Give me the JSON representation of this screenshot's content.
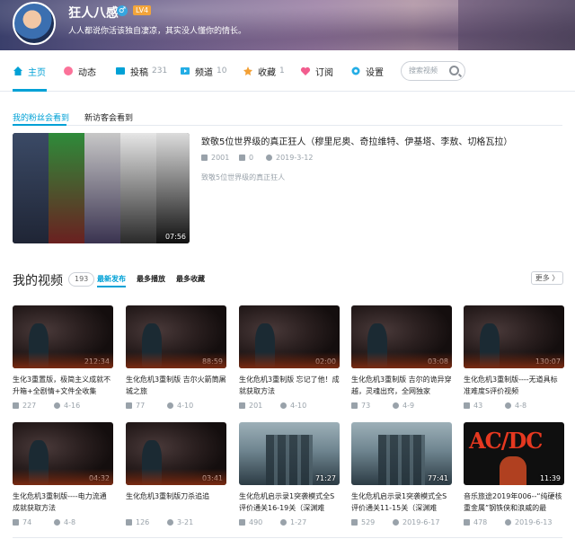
{
  "header": {
    "username": "狂人八感",
    "gender_icon": "male-icon",
    "level": "LV4",
    "signature": "人人都说你活该独自凄凉，其实没人懂你的情长。"
  },
  "nav": {
    "items": [
      {
        "label": "主页",
        "icon": "home-icon",
        "count": ""
      },
      {
        "label": "动态",
        "icon": "activity-icon",
        "count": ""
      },
      {
        "label": "投稿",
        "icon": "upload-icon",
        "count": "231"
      },
      {
        "label": "频道",
        "icon": "channel-icon",
        "count": "10"
      },
      {
        "label": "收藏",
        "icon": "star-icon",
        "count": "1"
      },
      {
        "label": "订阅",
        "icon": "heart-icon",
        "count": ""
      },
      {
        "label": "设置",
        "icon": "gear-icon",
        "count": ""
      }
    ],
    "search_placeholder": "搜索视频",
    "accent": "#00a1d6"
  },
  "featured": {
    "tabs": [
      "我的粉丝会看到",
      "新访客会看到"
    ],
    "title": "致敬5位世界级的真正狂人（穆里尼奥、奇拉维特、伊基塔、李敖、切格瓦拉）",
    "plays": "2001",
    "danmaku": "0",
    "date": "2019-3-12",
    "description": "致敬5位世界级的真正狂人",
    "duration": "07:56"
  },
  "videos_section": {
    "title": "我的视频",
    "count": "193",
    "sorts": [
      "最新发布",
      "最多播放",
      "最多收藏"
    ],
    "more": "更多 〉"
  },
  "videos": [
    {
      "title": "生化3重置版，极简主义成就不升箱+全剧情+文件全收集",
      "duration": "212:34",
      "plays": "227",
      "date": "4-16",
      "thumb": "re3"
    },
    {
      "title": "生化危机3重制版 吉尔火箭筒屠城之旅",
      "duration": "88:59",
      "plays": "77",
      "date": "4-10",
      "thumb": "re3"
    },
    {
      "title": "生化危机3重制版 忘记了他！成就获取方法",
      "duration": "02:00",
      "plays": "201",
      "date": "4-10",
      "thumb": "re3"
    },
    {
      "title": "生化危机3重制版 吉尔的诡异穿越，灵魂出窍，全网独家",
      "duration": "03:08",
      "plays": "73",
      "date": "4-9",
      "thumb": "re3"
    },
    {
      "title": "生化危机3重制版----无道具标准难度S评价视频",
      "duration": "130:07",
      "plays": "43",
      "date": "4-8",
      "thumb": "re3"
    },
    {
      "title": "生化危机3重制版----电力流通成就获取方法",
      "duration": "04:32",
      "plays": "74",
      "date": "4-8",
      "thumb": "re3"
    },
    {
      "title": "生化危机3重制版刀杀追追",
      "duration": "03:41",
      "plays": "126",
      "date": "3-21",
      "thumb": "re3"
    },
    {
      "title": "生化危机启示录1突袭模式全S评价通关16-19关（深渊难",
      "duration": "71:27",
      "plays": "490",
      "date": "1-27",
      "thumb": "rez"
    },
    {
      "title": "生化危机启示录1突袭模式全S评价通关11-15关（深渊难",
      "duration": "77:41",
      "plays": "529",
      "date": "2019-6-17",
      "thumb": "rez"
    },
    {
      "title": "音乐旅途2019年006--“纯硬核重金属”钢铁侠和浪威的最",
      "duration": "11:39",
      "plays": "478",
      "date": "2019-6-13",
      "thumb": "acdc",
      "thumb_text": "AC/DC"
    }
  ]
}
